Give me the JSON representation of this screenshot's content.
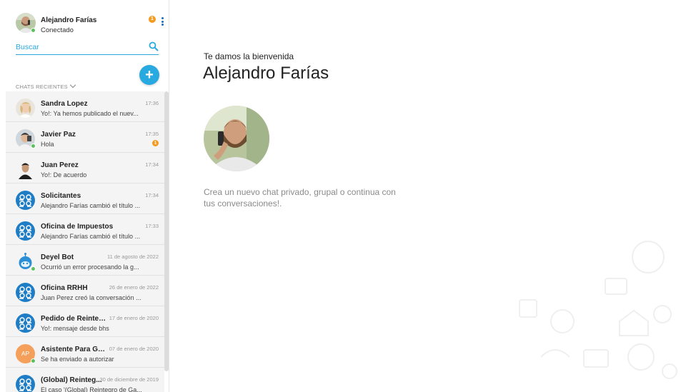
{
  "user": {
    "name": "Alejandro Farías",
    "status": "Conectado",
    "notification_count": "1"
  },
  "search": {
    "placeholder": "Buscar"
  },
  "section": {
    "recent_chats_label": "CHATS RECIENTES"
  },
  "chats": [
    {
      "name": "Sandra Lopez",
      "time": "17:36",
      "preview": "Yo!: Ya hemos publicado el nuev...",
      "avatar": "photo-woman"
    },
    {
      "name": "Javier Paz",
      "time": "17:35",
      "preview": "Hola",
      "badge": "1",
      "avatar": "photo-man",
      "online": true
    },
    {
      "name": "Juan Perez",
      "time": "17:34",
      "preview": "Yo!: De acuerdo",
      "avatar": "photo-man-dark"
    },
    {
      "name": "Solicitantes",
      "time": "17:34",
      "preview": "Alejandro Farías cambió el título ...",
      "avatar": "group-icon"
    },
    {
      "name": "Oficina de Impuestos",
      "time": "17:33",
      "preview": "Alejandro Farías cambió el título ...",
      "avatar": "group-icon"
    },
    {
      "name": "Deyel Bot",
      "time": "11 de agosto de 2022",
      "preview": "Ocurrió un error procesando la g...",
      "avatar": "bot-icon",
      "online": true
    },
    {
      "name": "Oficina RRHH",
      "time": "26 de enero de 2022",
      "preview": "Juan Perez creó la conversación ...",
      "avatar": "group-icon"
    },
    {
      "name": "Pedido de Reintegr...",
      "time": "17 de enero de 2020",
      "preview": "Yo!: mensaje desde bhs",
      "avatar": "group-icon"
    },
    {
      "name": "Asistente Para Gest...",
      "time": "07 de enero de 2020",
      "preview": "Se ha enviado a autorizar",
      "avatar": "initials",
      "initials": "AP",
      "online": true
    },
    {
      "name": "(Global) Reinteg...",
      "time": "30 de diciembre de 2019",
      "preview": "El caso '(Global) Reintegro de Ga...",
      "avatar": "group-icon"
    }
  ],
  "main": {
    "welcome": "Te damos la bienvenida",
    "name": "Alejandro Farías",
    "prompt": "Crea un nuevo chat privado, grupal o continua con tus conversaciones!."
  },
  "colors": {
    "accent": "#28a9e0",
    "group_avatar": "#1f7dc6",
    "badge": "#f39a1f",
    "online": "#5cc15c"
  }
}
